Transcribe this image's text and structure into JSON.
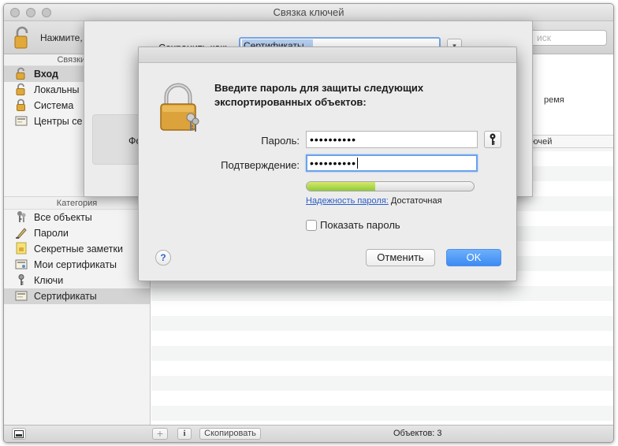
{
  "window": {
    "title": "Связка ключей"
  },
  "toolbar": {
    "lock_hint": "Нажмите,",
    "search_placeholder": "иск"
  },
  "sidebar": {
    "keychains_header": "Связки кл",
    "keychains": [
      {
        "label": "Вход",
        "icon": "lock-open-icon",
        "bold": true,
        "selected": true
      },
      {
        "label": "Локальны",
        "icon": "lock-open-icon",
        "bold": false,
        "selected": false
      },
      {
        "label": "Система",
        "icon": "lock-icon",
        "bold": false,
        "selected": false
      },
      {
        "label": "Центры се",
        "icon": "cert-folder-icon",
        "bold": false,
        "selected": false
      }
    ],
    "category_header": "Категория",
    "categories": [
      {
        "label": "Все объекты",
        "icon": "all-items-icon",
        "selected": false
      },
      {
        "label": "Пароли",
        "icon": "pen-icon",
        "selected": false
      },
      {
        "label": "Секретные заметки",
        "icon": "note-icon",
        "selected": false
      },
      {
        "label": "Мои сертификаты",
        "icon": "my-cert-icon",
        "selected": false
      },
      {
        "label": "Ключи",
        "icon": "key-icon",
        "selected": false
      },
      {
        "label": "Сертификаты",
        "icon": "cert-icon",
        "selected": true
      }
    ]
  },
  "list": {
    "partial_text_right": "ремя",
    "partial_column_header": "лючей"
  },
  "statusbar": {
    "copy_button": "Скопировать",
    "count": "Объектов: 3",
    "add_symbol": "+",
    "info_symbol": "i"
  },
  "save_sheet": {
    "save_as_label": "Сохранить как:",
    "filename": "Сертификаты",
    "format_label": "Фо"
  },
  "dialog": {
    "heading": "Введите пароль для защиты следующих экспортированных объектов:",
    "password_label": "Пароль:",
    "password_value": "••••••••••",
    "confirm_label": "Подтверждение:",
    "confirm_value": "••••••••••",
    "strength_link": "Надежность пароля:",
    "strength_value": "Достаточная",
    "strength_fraction": 0.41,
    "show_password_label": "Показать пароль",
    "show_password_checked": false,
    "help_symbol": "?",
    "cancel_label": "Отменить",
    "ok_label": "OK"
  },
  "colors": {
    "accent": "#3d8af3",
    "link": "#2b5ec7",
    "selection": "#d4d4d4"
  }
}
